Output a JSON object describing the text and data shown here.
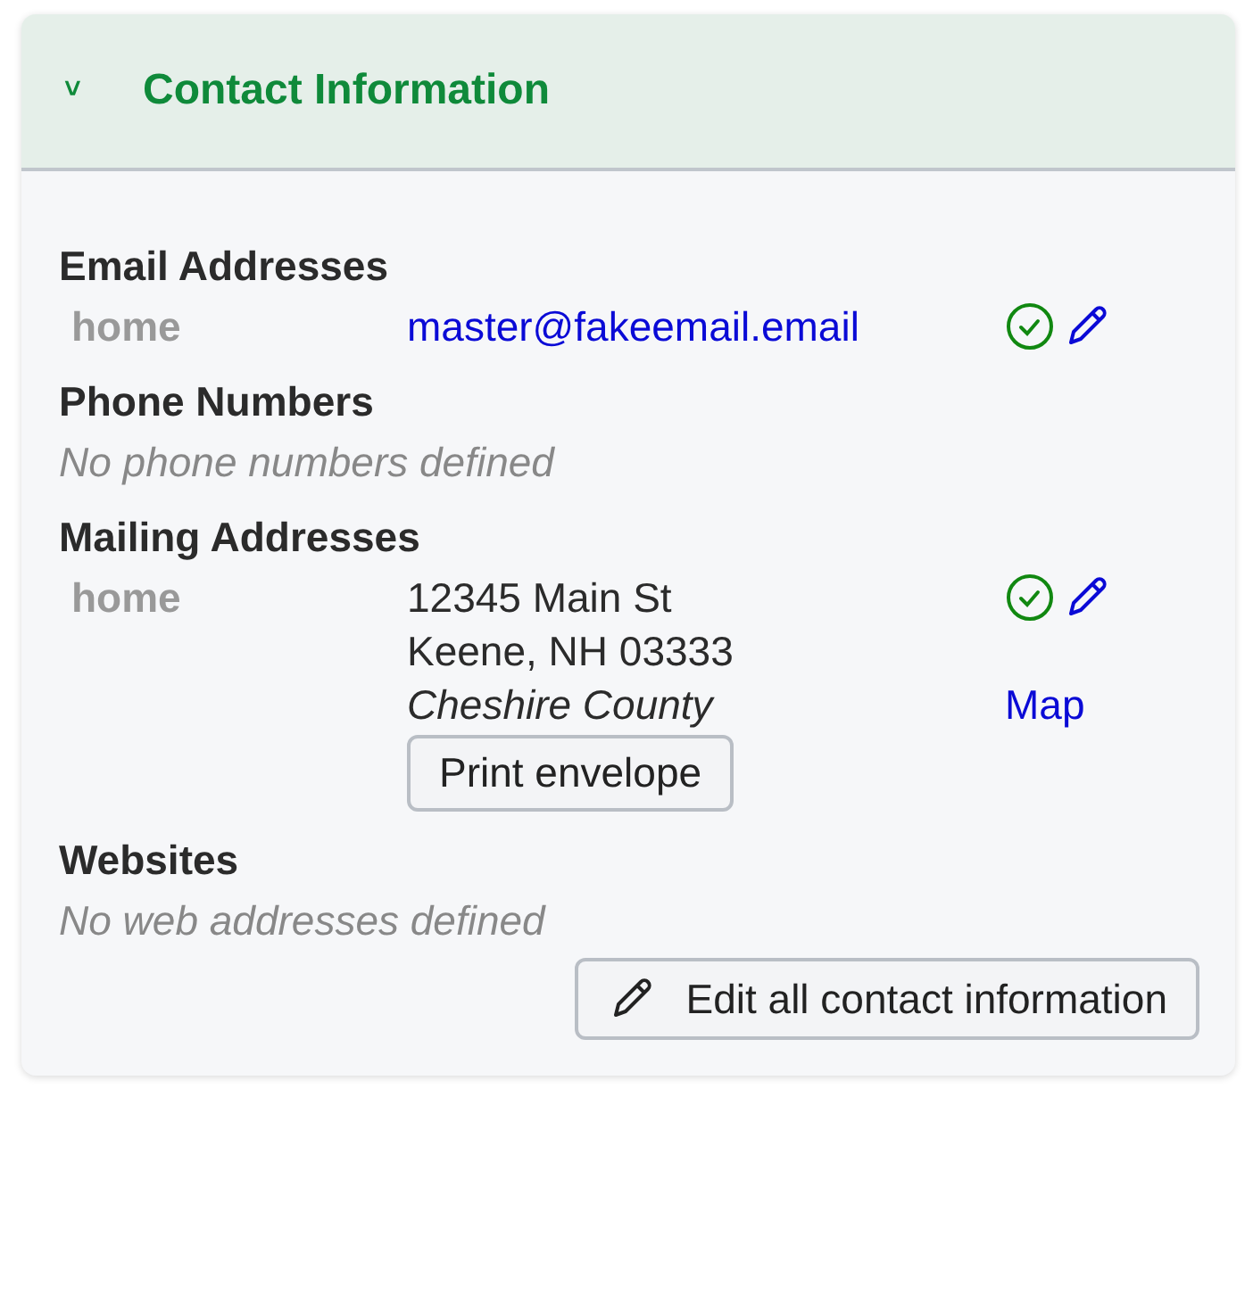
{
  "panel": {
    "title": "Contact Information",
    "expanded": true,
    "chevron": "˅"
  },
  "sections": [
    {
      "heading": "Email Addresses",
      "entries": [
        {
          "kind": "email",
          "label": "home",
          "value": "master@fakeemail.email",
          "verified": true
        }
      ]
    },
    {
      "heading": "Phone Numbers",
      "empty_message": "No phone numbers defined"
    },
    {
      "heading": "Mailing Addresses",
      "entries": [
        {
          "kind": "address",
          "label": "home",
          "lines": [
            "12345 Main St",
            "Keene, NH 03333"
          ],
          "county": "Cheshire County",
          "verified": true,
          "map_link": "Map",
          "button": "Print envelope"
        }
      ]
    },
    {
      "heading": "Websites",
      "empty_message": "No web addresses defined"
    }
  ],
  "footer_button": "Edit all contact information"
}
